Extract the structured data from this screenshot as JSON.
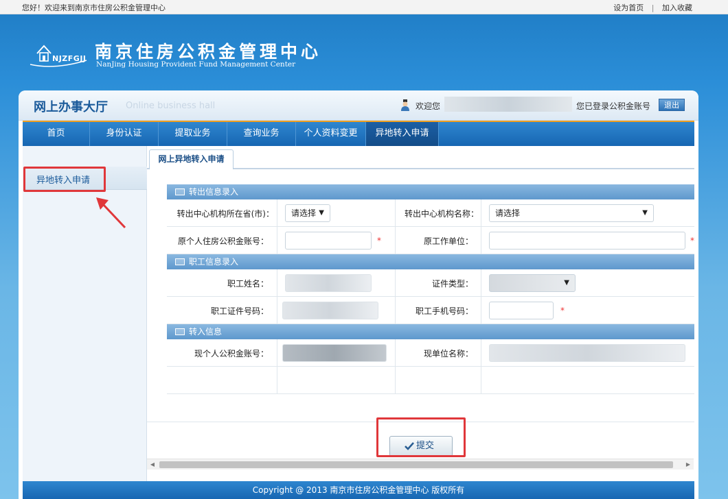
{
  "topbar": {
    "welcome": "您好！欢迎来到南京市住房公积金管理中心",
    "set_home": "设为首页",
    "separator": "|",
    "add_favorite": "加入收藏"
  },
  "header": {
    "logo_abbr": "NJZFGJJ",
    "title": "南京住房公积金管理中心",
    "subtitle": "NanJing Housing Provident Fund Management Center"
  },
  "panel": {
    "hall_title": "网上办事大厅",
    "hall_subtitle": "Online business hall",
    "greeting": "欢迎您",
    "login_note": "您已登录公积金账号",
    "logout_label": "退出"
  },
  "nav": {
    "items": [
      "首页",
      "身份认证",
      "提取业务",
      "查询业务",
      "个人资料变更",
      "异地转入申请"
    ],
    "active_index": 5
  },
  "sidebar": {
    "items": [
      "异地转入申请"
    ]
  },
  "tab": {
    "label": "网上异地转入申请"
  },
  "form": {
    "sections": [
      "转出信息录入",
      "职工信息录入",
      "转入信息"
    ],
    "fields": {
      "out_province_label": "转出中心机构所在省(市)：",
      "out_province_value": "请选择",
      "out_center_label": "转出中心机构名称：",
      "out_center_value": "请选择",
      "orig_account_label": "原个人住房公积金账号：",
      "orig_account_value": "",
      "orig_employer_label": "原工作单位：",
      "orig_employer_value": "",
      "name_label": "职工姓名：",
      "id_type_label": "证件类型：",
      "id_number_label": "职工证件号码：",
      "phone_label": "职工手机号码：",
      "phone_value": "",
      "cur_account_label": "现个人公积金账号：",
      "cur_employer_label": "现单位名称："
    },
    "required_mark": "*",
    "caret": "▼"
  },
  "submit": {
    "label": "提交"
  },
  "scroll": {
    "left": "◀",
    "right": "▶"
  },
  "footer": {
    "copyright": "Copyright @ 2013 南京市住房公积金管理中心 版权所有"
  },
  "colors": {
    "brand_blue": "#1766b2",
    "nav_accent": "#f0a020",
    "highlight_red": "#e0373a"
  }
}
